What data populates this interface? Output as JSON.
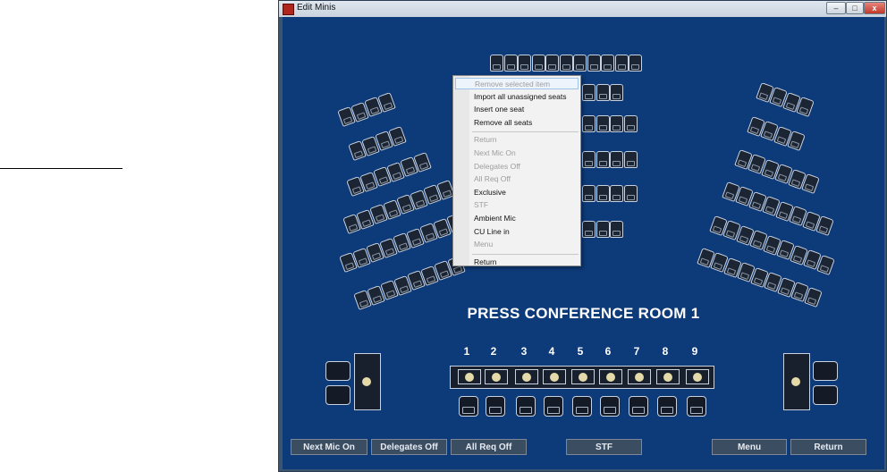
{
  "window": {
    "title": "Edit Minis",
    "minimize_glyph": "–",
    "maximize_glyph": "□",
    "close_glyph": "x"
  },
  "room": {
    "title": "PRESS CONFERENCE ROOM 1"
  },
  "mic_numbers": [
    "1",
    "2",
    "3",
    "4",
    "5",
    "6",
    "7",
    "8",
    "9"
  ],
  "context_menu": [
    {
      "label": "Remove selected item",
      "enabled": false,
      "highlighted": true
    },
    {
      "label": "Import all unassigned seats",
      "enabled": true
    },
    {
      "label": "Insert one seat",
      "enabled": true
    },
    {
      "label": "Remove all seats",
      "enabled": true
    },
    {
      "separator": true
    },
    {
      "label": "Return",
      "enabled": false
    },
    {
      "label": "Next Mic On",
      "enabled": false
    },
    {
      "label": "Delegates Off",
      "enabled": false
    },
    {
      "label": "All Req Off",
      "enabled": false
    },
    {
      "label": "Exclusive",
      "enabled": true
    },
    {
      "label": "STF",
      "enabled": false
    },
    {
      "label": "Ambient Mic",
      "enabled": true
    },
    {
      "label": "CU Line in",
      "enabled": true
    },
    {
      "label": "Menu",
      "enabled": false
    },
    {
      "separator": true
    },
    {
      "label": "Return",
      "enabled": true
    }
  ],
  "buttons": {
    "next_mic_on": "Next Mic On",
    "delegates_off": "Delegates Off",
    "all_req_off": "All Req Off",
    "stf": "STF",
    "menu": "Menu",
    "return": "Return"
  },
  "colors": {
    "canvas": "#0d3a78",
    "seat_outline": "#c9d2e0",
    "mic_dot": "#e3d9a9"
  }
}
